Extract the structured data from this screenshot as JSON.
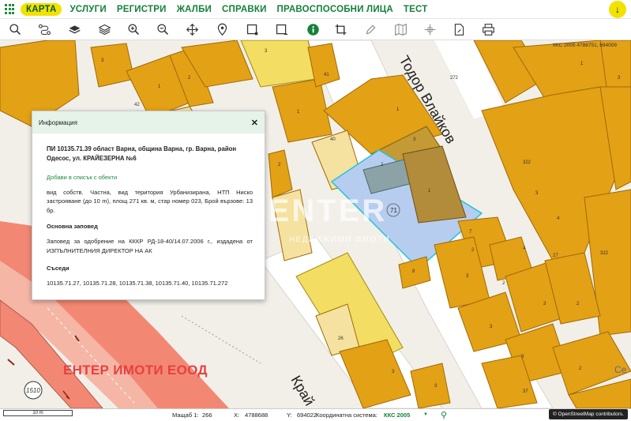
{
  "nav": {
    "items": [
      "КАРТА",
      "УСЛУГИ",
      "РЕГИСТРИ",
      "ЖАЛБИ",
      "СПРАВКИ",
      "ПРАВОСПОСОБНИ ЛИЦА",
      "ТЕСТ"
    ],
    "active": "КАРТА"
  },
  "toolbar": {
    "icons": [
      "search-icon",
      "route-icon",
      "layers-icon",
      "layers-stack-icon",
      "zoom-in-icon",
      "zoom-out-icon",
      "pan-icon",
      "location-pin-icon",
      "select-rect-icon",
      "select-rect-plus-icon",
      "info-icon",
      "crop-icon",
      "pencil-icon",
      "map-icon",
      "measure-icon",
      "document-icon",
      "print-icon"
    ]
  },
  "map": {
    "street_1": "Тодор Влайков",
    "street_2": "Край",
    "kks_label": "ККС 2005 4788751, 694009",
    "parcel_label": "71",
    "road_badge": "1510",
    "caption": "ЕНТЕР ИМОТИ ЕООД",
    "watermark": "ENTER",
    "watermark_sub": "НЕДВИЖИМИ ИМОТИ",
    "building_labels": [
      "3",
      "1",
      "2",
      "1",
      "3",
      "1",
      "3",
      "2",
      "41",
      "42",
      "40",
      "272",
      "322",
      "322",
      "3",
      "2",
      "3",
      "4",
      "3",
      "27",
      "8",
      "7",
      "3",
      "2",
      "3",
      "37",
      "3",
      "26",
      "3",
      "2",
      "2",
      "3",
      "1",
      "2",
      "1",
      "4",
      "Се"
    ]
  },
  "popup": {
    "header": "Информация",
    "title": "ПИ 10135.71.39 област Варна, община Варна, гр. Варна, район Одесос, ул. КРАЙЕЗЕРНА №6",
    "add_link": "Добави в списък с обекти",
    "description": "вид собств. Частна, вид територия Урбанизирана, НТП Ниско застрояване (до 10 m), площ 271 кв. м, стар номер 023, Брой вързове: 13 бр.",
    "order_heading": "Основна заповед",
    "order_text": "Заповед за одобрение на КККР РД-18-40/14.07.2006 г., издадена от ИЗПЪЛНИТЕЛНИЯ ДИРЕКТОР НА АК",
    "neighbors_heading": "Съседи",
    "neighbors": "10135.71.27, 10135.71.28, 10135.71.38, 10135.71.40, 10135.71.272"
  },
  "status": {
    "scale_label": "Мащаб 1:",
    "scale_value": "266",
    "x_label": "X:",
    "x_value": "4788688",
    "y_label": "Y:",
    "y_value": "694022",
    "cs_label": "Координатна система:",
    "cs_value": "ККС 2005",
    "osm": "© OpenStreetMap contributors.",
    "scale_bar": "10 m"
  },
  "colors": {
    "building": "#e3a116",
    "building_light": "#f3dd62",
    "road_red": "#f28873",
    "selection": "#b7cdf0",
    "brand_green": "#14813a"
  }
}
